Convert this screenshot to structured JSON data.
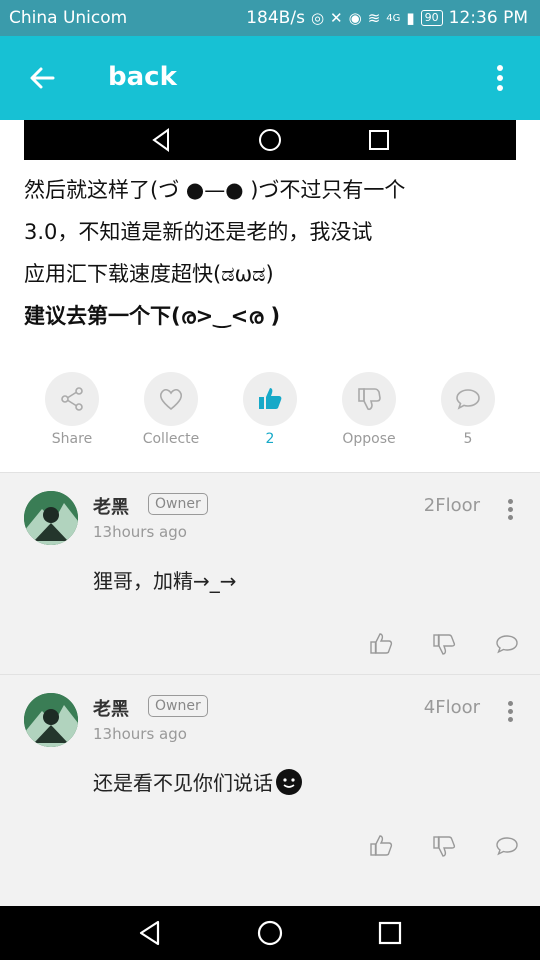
{
  "status_bar": {
    "carrier": "China Unicom",
    "speed": "184B/s",
    "battery": "90",
    "network": "4G",
    "time": "12:36 PM"
  },
  "app_bar": {
    "title": "back"
  },
  "post": {
    "lines": [
      "然后就这样了(づ ●—● )づ不过只有一个",
      "3.0，不知道是新的还是老的，我没试",
      "应用汇下载速度超快(ಡωಡ)",
      "建议去第一个下(ര>‿<ര )"
    ],
    "actions": [
      {
        "label": "Share"
      },
      {
        "label": "Collecte"
      },
      {
        "label": "2"
      },
      {
        "label": "Oppose"
      },
      {
        "label": "5"
      }
    ]
  },
  "comments": [
    {
      "username": "老黑",
      "badge": "Owner",
      "floor": "2Floor",
      "time": "13hours ago",
      "text": "狸哥，加精→_→"
    },
    {
      "username": "老黑",
      "badge": "Owner",
      "floor": "4Floor",
      "time": "13hours ago",
      "text": "还是看不见你们说话"
    }
  ],
  "colors": {
    "accent": "#17c1d4",
    "status_bar": "#3a9bab",
    "like_active": "#17a9c8"
  }
}
